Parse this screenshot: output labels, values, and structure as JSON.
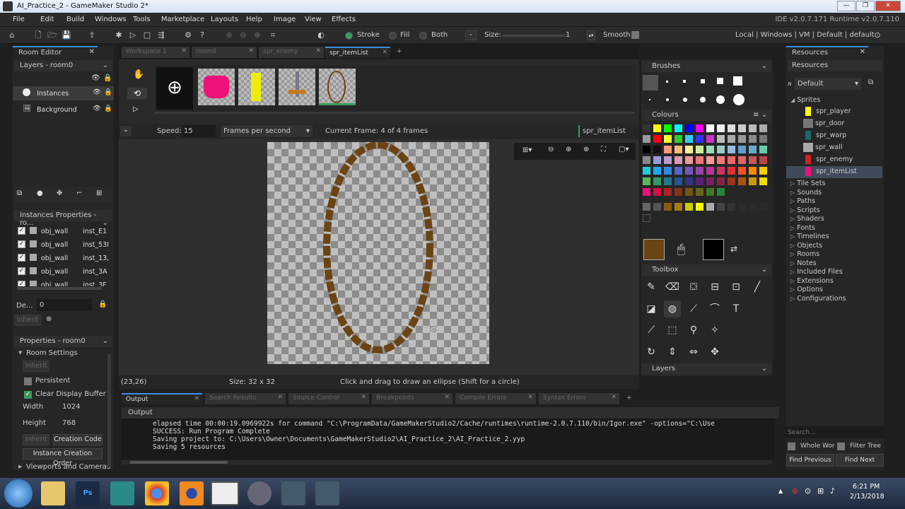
{
  "window": {
    "title": "AI_Practice_2 - GameMaker Studio 2*",
    "min": "—",
    "max": "❐",
    "close": "✕"
  },
  "menu": {
    "items": [
      "File",
      "Edit",
      "Build",
      "Windows",
      "Tools",
      "Marketplace",
      "Layouts",
      "Help",
      "Image",
      "View",
      "Effects"
    ],
    "version": "IDE v2.0.7.171 Runtime v2.0.7.110"
  },
  "toolbar": {
    "stroke": "Stroke",
    "fill": "Fill",
    "both": "Both",
    "size_label": "Size:",
    "size_value": "1",
    "smooth": "Smooth",
    "targets": "Local  |  Windows  |  VM  |  Default  |  default"
  },
  "room_editor": {
    "tab": "Room Editor",
    "layers_title": "Layers - room0",
    "layers": [
      "Instances",
      "Background"
    ],
    "instances_title": "Instances Properties - ro...",
    "instances": [
      {
        "obj": "obj_wall",
        "id": "inst_E1"
      },
      {
        "obj": "obj_wall",
        "id": "inst_53I"
      },
      {
        "obj": "obj_wall",
        "id": "inst_13,"
      },
      {
        "obj": "obj_wall",
        "id": "inst_3A"
      },
      {
        "obj": "obj_wall",
        "id": "inst_3F"
      }
    ],
    "depth_label": "De...",
    "depth_value": "0",
    "inherit": "Inherit",
    "props_title": "Properties - room0",
    "room_settings": "Room Settings",
    "persistent": "Persistent",
    "clear_display": "Clear Display Buffer",
    "width_label": "Width",
    "width_value": "1024",
    "height_label": "Height",
    "height_value": "768",
    "creation_code": "Creation Code",
    "instance_creation_order": "Instance Creation Order",
    "viewports": "Viewports and Cameras"
  },
  "workspace_tabs": [
    "Workspace 1",
    "room0",
    "spr_enemy",
    "spr_itemList"
  ],
  "sprite_editor": {
    "speed_label": "Speed:",
    "speed_value": "15",
    "speed_unit": "Frames per second",
    "current_frame": "Current Frame: 4 of 4 frames",
    "sprite_name": "spr_itemList",
    "status_coords": "(23,26)",
    "status_size": "Size: 32 x 32",
    "status_hint": "Click and drag to draw an ellipse (Shift for a circle)"
  },
  "brushes": {
    "title": "Brushes"
  },
  "colours": {
    "title": "Colours",
    "palette": [
      "#333333",
      "#ffff00",
      "#00ff00",
      "#00ffff",
      "#0000ff",
      "#ff00ff",
      "#ffffff",
      "#eeeeee",
      "#dddddd",
      "#cccccc",
      "#bbbbbb",
      "#aaaaaa",
      "#999999",
      "#ff0000",
      "#ffff33",
      "#33cc33",
      "#33ccff",
      "#3333ff",
      "#cc33cc",
      "#bbbbbb",
      "#aaaaaa",
      "#999999",
      "#888888",
      "#777777",
      "#000000",
      "#111111",
      "#ff9977",
      "#ffbb77",
      "#ffee99",
      "#ccee99",
      "#99ddbb",
      "#99cccc",
      "#99bbdd",
      "#6699cc",
      "#66aacc",
      "#66ccaa",
      "#888888",
      "#9999dd",
      "#bb99cc",
      "#dd99bb",
      "#ee9999",
      "#ee7777",
      "#ff9999",
      "#ff7777",
      "#ee6666",
      "#dd6666",
      "#cc5555",
      "#bb4444",
      "#22ccdd",
      "#22aaee",
      "#3388dd",
      "#5566cc",
      "#7755bb",
      "#9944aa",
      "#bb3399",
      "#cc3366",
      "#dd3333",
      "#ee5522",
      "#ff8800",
      "#ffcc00",
      "#55bb55",
      "#339966",
      "#227788",
      "#225599",
      "#333388",
      "#552277",
      "#772266",
      "#882244",
      "#993322",
      "#aa5511",
      "#cc9900",
      "#eedd00",
      "#ee1177",
      "#cc1144",
      "#aa2222",
      "#883311",
      "#775511",
      "#666622",
      "#447722",
      "#228833",
      "#666666",
      "#555555",
      "#8b5a0f",
      "#aa7711",
      "#cccc00",
      "#ffff00",
      "#aaaaaa",
      "#444444",
      "#333333",
      "#2a2a2a",
      "#2a2a2a",
      "#2a2a2a"
    ],
    "primary": "#6b4414",
    "secondary": "#000000"
  },
  "toolbox": {
    "title": "Toolbox",
    "layers": "Layers"
  },
  "resources": {
    "tab": "Resources",
    "title": "Resources",
    "filter": "Default",
    "sprites_label": "Sprites",
    "sprites": [
      "spr_player",
      "spr_door",
      "spr_warp",
      "spr_wall",
      "spr_enemy",
      "spr_itemList"
    ],
    "groups": [
      "Tile Sets",
      "Sounds",
      "Paths",
      "Scripts",
      "Shaders",
      "Fonts",
      "Timelines",
      "Objects",
      "Rooms",
      "Notes",
      "Included Files",
      "Extensions",
      "Options",
      "Configurations"
    ],
    "search_placeholder": "Search...",
    "whole_word": "Whole Wor",
    "filter_tree": "Filter Tree",
    "find_prev": "Find Previous",
    "find_next": "Find Next"
  },
  "output": {
    "tabs": [
      "Output",
      "Search Results",
      "Source Control",
      "Breakpoints",
      "Compile Errors",
      "Syntax Errors"
    ],
    "title": "Output",
    "lines": [
      "elapsed time 00:00:19.0969922s for command \"C:\\ProgramData/GameMakerStudio2/Cache/runtimes\\runtime-2.0.7.110/bin/Igor.exe\" -options=\"C:\\Use",
      "SUCCESS: Run Program Complete",
      "Saving project to: C:\\Users\\Owner\\Documents\\GameMakerStudio2\\AI_Practice_2\\AI_Practice_2.yyp",
      "Saving 5 resources"
    ]
  },
  "taskbar": {
    "time": "6:21 PM",
    "date": "2/13/2018"
  }
}
